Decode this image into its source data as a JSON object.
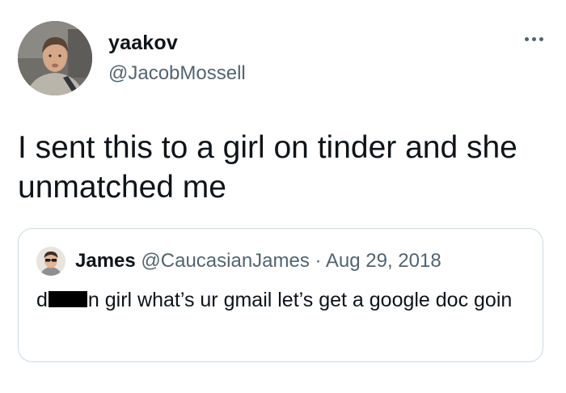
{
  "author": {
    "display_name": "yaakov",
    "handle": "@JacobMossell"
  },
  "more_icon": "more-dots-icon",
  "tweet": {
    "text": "I sent this to a girl on tinder and she unmatched me"
  },
  "quoted_tweet": {
    "display_name": "James",
    "handle": "@CaucasianJames",
    "separator": "·",
    "date": "Aug 29, 2018",
    "text_start": "d",
    "text_rest": "n girl what’s ur gmail let’s get a google doc goin"
  },
  "colors": {
    "text_primary": "#0f1419",
    "text_secondary": "#536471",
    "border": "#cfd9de",
    "censor_bar": "#000000"
  }
}
